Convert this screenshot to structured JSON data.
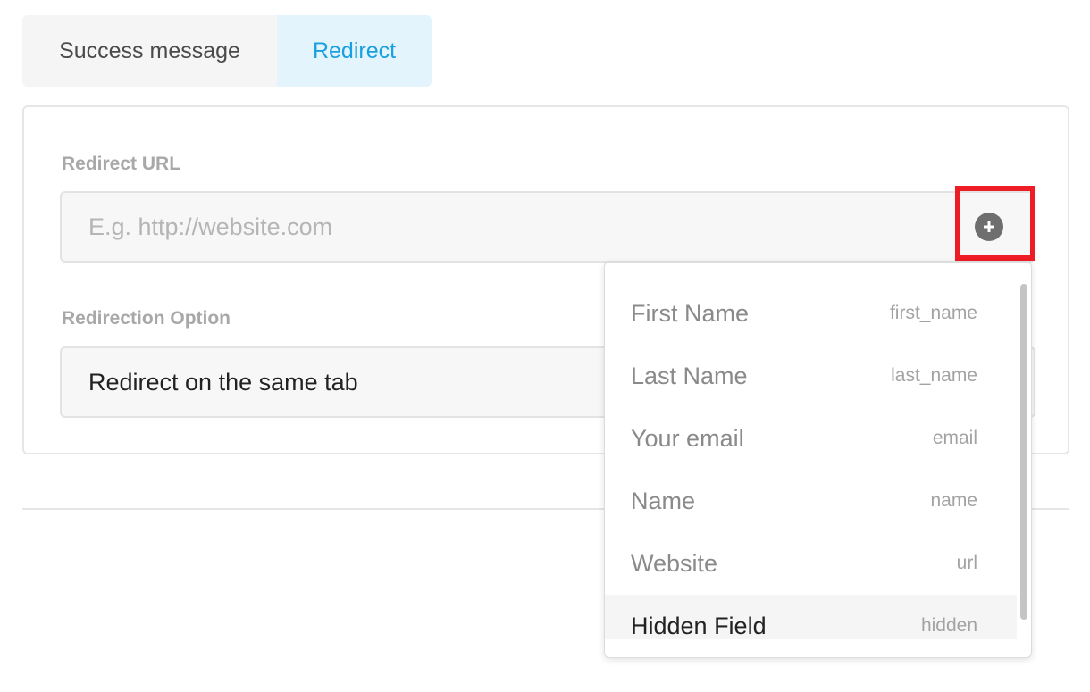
{
  "tabs": [
    {
      "label": "Success message",
      "selected": false
    },
    {
      "label": "Redirect",
      "selected": true
    }
  ],
  "redirect_url": {
    "label": "Redirect URL",
    "value": "",
    "placeholder": "E.g. http://website.com"
  },
  "redirection_option": {
    "label": "Redirection Option",
    "selected": "Redirect on the same tab"
  },
  "add_field_button": {
    "icon": "plus-circle-icon"
  },
  "field_dropdown": {
    "items": [
      {
        "label": "First Name",
        "key": "first_name"
      },
      {
        "label": "Last Name",
        "key": "last_name"
      },
      {
        "label": "Your email",
        "key": "email"
      },
      {
        "label": "Name",
        "key": "name"
      },
      {
        "label": "Website",
        "key": "url"
      },
      {
        "label": "Hidden Field",
        "key": "hidden"
      }
    ],
    "hovered_index": 5
  },
  "colors": {
    "accent": "#1a9fe0",
    "tab_active_bg": "#e3f4fd",
    "highlight": "#ee1c25"
  }
}
